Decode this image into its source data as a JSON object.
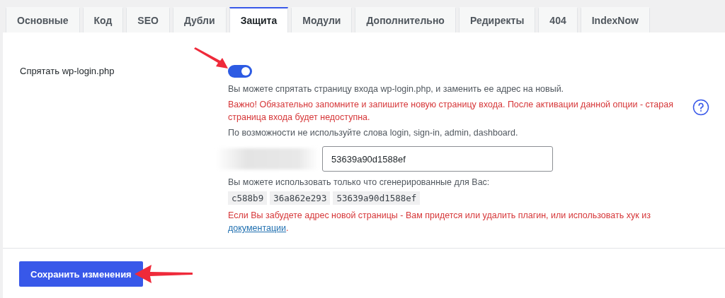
{
  "tabs": [
    {
      "label": "Основные",
      "selected": false
    },
    {
      "label": "Код",
      "selected": false
    },
    {
      "label": "SEO",
      "selected": false
    },
    {
      "label": "Дубли",
      "selected": false
    },
    {
      "label": "Защита",
      "selected": true
    },
    {
      "label": "Модули",
      "selected": false
    },
    {
      "label": "Дополнительно",
      "selected": false
    },
    {
      "label": "Редиректы",
      "selected": false
    },
    {
      "label": "404",
      "selected": false
    },
    {
      "label": "IndexNow",
      "selected": false
    }
  ],
  "setting": {
    "label": "Спрятать wp-login.php",
    "toggle": {
      "on": true
    },
    "notes": [
      {
        "kind": "info",
        "text": "Вы можете спрятать страницу входа wp-login.php, и заменить ее адрес на новый."
      },
      {
        "kind": "warning",
        "text": "Важно! Обязательно запомните и запишите новую страницу входа. После активации данной опции - старая страница входа будет недоступна."
      },
      {
        "kind": "info",
        "text": "По возможности не используйте слова login, sign-in, admin, dashboard."
      }
    ],
    "slug_field": {
      "value": "53639a90d1588ef"
    },
    "suggestions_label": "Вы можете использовать только что сгенерированные для Вас:",
    "suggestions": [
      "c588b9",
      "36a862e293",
      "53639a90d1588ef"
    ],
    "final_warning": {
      "text": "Если Вы забудете адрес новой страницы - Вам придется или удалить плагин, или использовать хук из",
      "link": "документации",
      "end": "."
    }
  },
  "save_button": "Сохранить изменения"
}
